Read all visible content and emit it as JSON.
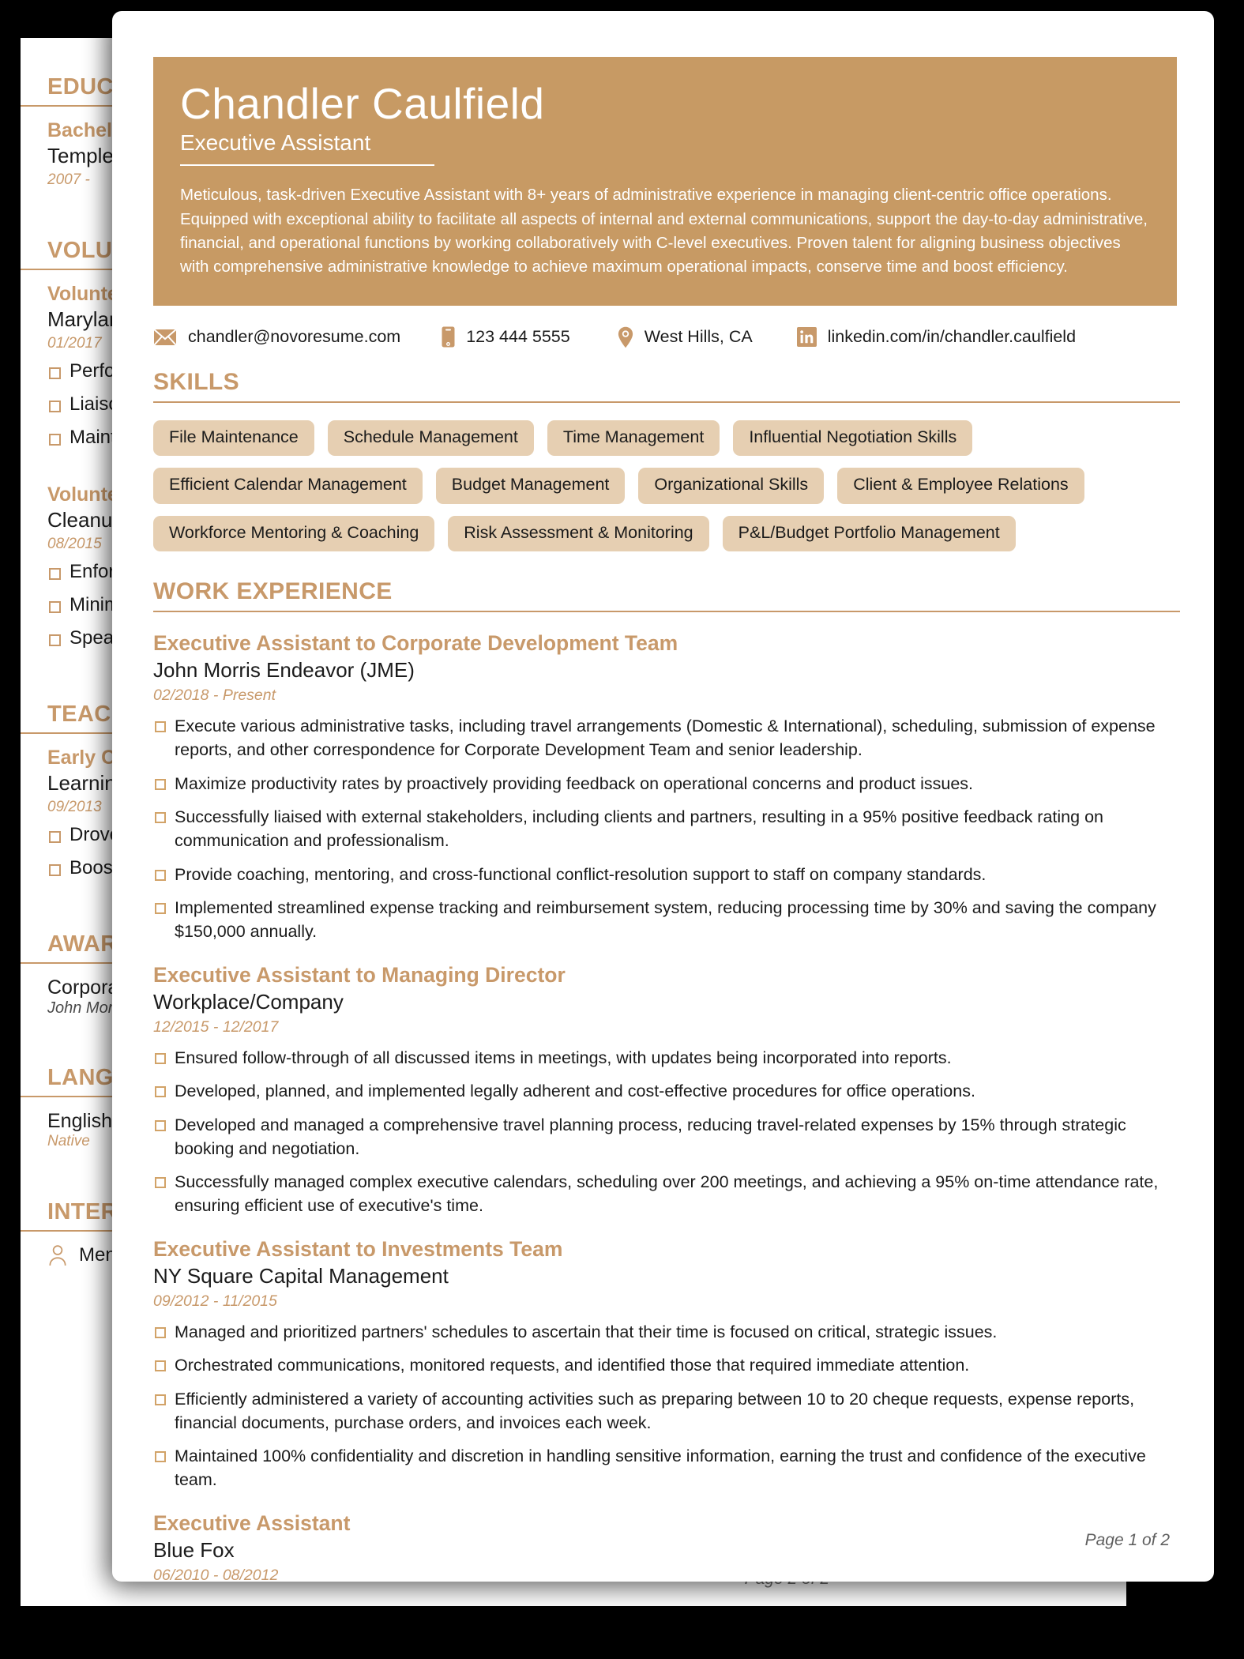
{
  "theme": {
    "accent": "#c8996a",
    "header_band": "#c79a64",
    "skill_tag_bg": "#e6cfb2",
    "text": "#1b1b1b",
    "page_bg": "#ffffff",
    "canvas_bg": "#000000"
  },
  "page_front": {
    "header": {
      "name": "Chandler Caulfield",
      "role": "Executive Assistant",
      "summary": "Meticulous, task-driven Executive Assistant with 8+ years of administrative experience in managing client-centric office operations. Equipped with exceptional ability to facilitate all aspects of internal and external communications, support the day-to-day administrative, financial, and operational functions by working collaboratively with C-level executives. Proven talent for aligning business objectives with comprehensive administrative knowledge to achieve maximum operational impacts, conserve time and boost efficiency."
    },
    "contact": [
      {
        "icon": "envelope-icon",
        "value": "chandler@novoresume.com",
        "name": "contact-email"
      },
      {
        "icon": "phone-icon",
        "value": "123 444 5555",
        "name": "contact-phone"
      },
      {
        "icon": "location-pin-icon",
        "value": "West Hills, CA",
        "name": "contact-location"
      },
      {
        "icon": "linkedin-icon",
        "value": "linkedin.com/in/chandler.caulfield",
        "name": "contact-linkedin"
      }
    ],
    "skills": {
      "heading": "SKILLS",
      "tags": [
        "File Maintenance",
        "Schedule Management",
        "Time Management",
        "Influential Negotiation Skills",
        "Efficient Calendar Management",
        "Budget Management",
        "Organizational Skills",
        "Client & Employee Relations",
        "Workforce Mentoring & Coaching",
        "Risk Assessment & Monitoring",
        "P&L/Budget Portfolio Management"
      ]
    },
    "work_experience": {
      "heading": "WORK EXPERIENCE",
      "jobs": [
        {
          "title": "Executive Assistant to Corporate Development Team",
          "organization": "John Morris Endeavor (JME)",
          "dates": "02/2018 - Present",
          "bullets": [
            "Execute various administrative tasks, including travel arrangements (Domestic & International), scheduling, submission of expense reports, and other correspondence for Corporate Development Team and senior leadership.",
            "Maximize productivity rates by proactively providing feedback on operational concerns and product issues.",
            "Successfully liaised with external stakeholders, including clients and partners, resulting in a 95% positive feedback rating on communication and professionalism.",
            "Provide coaching, mentoring, and cross-functional conflict-resolution support to staff on company standards.",
            "Implemented streamlined expense tracking and reimbursement system, reducing processing time by 30% and saving the company $150,000 annually."
          ]
        },
        {
          "title": "Executive Assistant to Managing Director",
          "organization": "Workplace/Company",
          "dates": "12/2015 - 12/2017",
          "bullets": [
            "Ensured follow-through of all discussed items in meetings, with updates being incorporated into reports.",
            "Developed, planned, and implemented legally adherent and cost-effective procedures for office operations.",
            "Developed and managed a comprehensive travel planning process, reducing travel-related expenses by 15% through strategic booking and negotiation.",
            "Successfully managed complex executive calendars, scheduling over 200 meetings, and achieving a 95% on-time attendance rate, ensuring efficient use of executive's time."
          ]
        },
        {
          "title": "Executive Assistant to Investments Team",
          "organization": "NY Square Capital Management",
          "dates": "09/2012 - 11/2015",
          "bullets": [
            "Managed and prioritized partners' schedules to ascertain that their time is focused on critical, strategic issues.",
            "Orchestrated communications, monitored requests, and identified those that required immediate attention.",
            "Efficiently administered a variety of accounting activities such as preparing between 10 to 20 cheque requests, expense reports, financial documents, purchase orders, and invoices each week.",
            "Maintained 100% confidentiality and discretion in handling sensitive information, earning the trust and confidence of the executive team."
          ]
        },
        {
          "title": "Executive Assistant",
          "organization": "Blue Fox",
          "dates": "06/2010 - 08/2012",
          "bullets": []
        }
      ]
    },
    "footer": "Page 1 of 2"
  },
  "page_back": {
    "sections": {
      "education": {
        "heading": "EDUCATION",
        "degree": "Bachelor",
        "school": "Temple",
        "dates": "2007 -"
      },
      "volunteering": {
        "heading": "VOLUNTEERING",
        "entries": [
          {
            "title": "Volunteer",
            "organization": "Maryland",
            "dates": "01/2017",
            "bullets": [
              "Perform",
              "Liaison",
              "Maintain"
            ]
          },
          {
            "title": "Volunteer",
            "organization": "Cleanup",
            "dates": "08/2015",
            "bullets": [
              "Enforce",
              "Minimize",
              "Spearhead"
            ]
          }
        ]
      },
      "teaching": {
        "heading": "TEACHING",
        "entries": [
          {
            "title": "Early Childhood",
            "organization": "Learning",
            "dates": "09/2013",
            "bullets": [
              "Drove",
              "Boosted"
            ]
          }
        ]
      },
      "awards": {
        "heading": "AWARDS",
        "title": "Corporate Award",
        "subtitle": "John Morris Endeavor"
      },
      "languages": {
        "heading": "LANGUAGES",
        "language": "English",
        "level": "Native"
      },
      "interests": {
        "heading": "INTERESTS",
        "items": [
          "Mentoring"
        ]
      }
    },
    "footer": "Page 2 of 2"
  }
}
